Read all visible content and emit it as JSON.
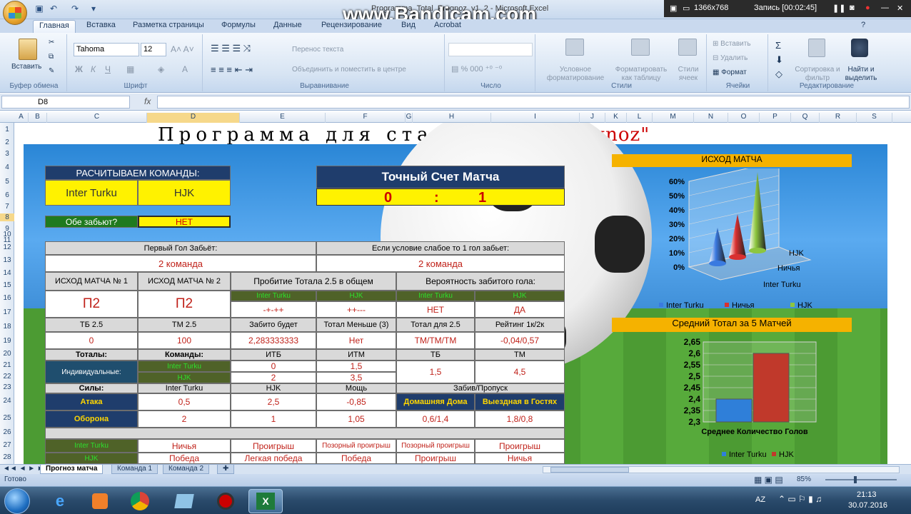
{
  "window": {
    "title": "Programma_Total_Prognoz_v1_2 - Microsoft Excel"
  },
  "recorder": {
    "watermark": "www.Bandicam.com",
    "resolution": "1366x768",
    "record_status": "Запись [00:02:45]"
  },
  "ribbon": {
    "tabs": [
      "Главная",
      "Вставка",
      "Разметка страницы",
      "Формулы",
      "Данные",
      "Рецензирование",
      "Вид",
      "Acrobat"
    ],
    "clipboard": {
      "paste": "Вставить",
      "group": "Буфер обмена"
    },
    "font": {
      "name": "Tahoma",
      "size": "12",
      "group": "Шрифт"
    },
    "alignment": {
      "wrap": "Перенос текста",
      "merge": "Объединить и поместить в центре",
      "group": "Выравнивание"
    },
    "number": {
      "group": "Число"
    },
    "styles": {
      "conditional": "Условное форматирование",
      "as_table": "Форматировать как таблицу",
      "cell_styles": "Стили ячеек",
      "group": "Стили"
    },
    "cells": {
      "insert": "Вставить",
      "delete": "Удалить",
      "format": "Формат",
      "group": "Ячейки"
    },
    "editing": {
      "sort": "Сортировка и фильтр",
      "find": "Найти и выделить",
      "group": "Редактирование"
    }
  },
  "formula_bar": {
    "name_box": "D8",
    "fx": "fx",
    "value": ""
  },
  "columns": [
    "A",
    "B",
    "C",
    "D",
    "E",
    "F",
    "G",
    "H",
    "I",
    "J",
    "K",
    "L",
    "M",
    "N",
    "O",
    "P",
    "Q",
    "R",
    "S"
  ],
  "rows": [
    "1",
    "2",
    "3",
    "4",
    "5",
    "6",
    "7",
    "8",
    "9",
    "10",
    "11",
    "12",
    "13",
    "14",
    "15",
    "16",
    "17",
    "18",
    "19",
    "20",
    "21",
    "22",
    "23",
    "24",
    "25",
    "26",
    "27",
    "28"
  ],
  "sheet": {
    "banner": "Программа для ставок",
    "banner_brand": "\"Total Prognoz\"",
    "calc_header": "РАСЧИТЫВАЕМ КОМАНДЫ:",
    "team1": "Inter Turku",
    "team2": "HJK",
    "score_header": "Точный Счет Матча",
    "score1": "0",
    "score_sep": ":",
    "score2": "1",
    "both_score_label": "Обе забьют?",
    "both_score_value": "НЕТ",
    "first_goal_h": "Первый Гол Забьёт:",
    "first_goal_v": "2 команда",
    "weak_h": "Если условие слабое то 1 гол забьет:",
    "weak_v": "2 команда",
    "outcome1_h": "ИСХОД МАТЧА № 1",
    "outcome2_h": "ИСХОД МАТЧА № 2",
    "outcome1_v": "П2",
    "outcome2_v": "П2",
    "total25_h": "Пробитие Тотала 2.5 в общем",
    "prob_h": "Вероятность забитого гола:",
    "team1_short": "Inter Turku",
    "team2_short": "HJK",
    "total25_t1": "-+-++",
    "total25_t2": "++---",
    "prob_t1": "НЕТ",
    "prob_t2": "ДА",
    "row18": [
      "ТБ 2.5",
      "ТМ 2.5",
      "Забито будет",
      "Тотал Меньше (3)",
      "Тотал для 2.5",
      "Рейтинг 1к/2к"
    ],
    "row19": [
      "0",
      "100",
      "2,283333333",
      "Нет",
      "ТМ/ТМ/ТМ",
      "-0,04/0,57"
    ],
    "row20": [
      "Тоталы:",
      "Команды:",
      "ИТБ",
      "ИТМ",
      "ТБ",
      "ТМ"
    ],
    "individual_label": "Индивидуальные:",
    "itb": [
      "0",
      "2"
    ],
    "itm": [
      "1,5",
      "3,5"
    ],
    "tb_val": "1,5",
    "tm_val": "4,5",
    "row23": [
      "Силы:",
      "Inter Turku",
      "HJK",
      "Мощь",
      "Забив/Пропуск"
    ],
    "attack_label": "Атака",
    "attack": [
      "0,5",
      "2,5",
      "-0,85"
    ],
    "home_label": "Домашняя Дома",
    "away_label": "Выездная в Гостях",
    "defense_label": "Оборона",
    "defense": [
      "2",
      "1",
      "1,05"
    ],
    "home_val": "0,6/1,4",
    "away_val": "1,8/0,8",
    "row27": [
      "Inter Turku",
      "Ничья",
      "Проигрыш",
      "Позорный проигрыш",
      "Позорный проигрыш",
      "Проигрыш"
    ],
    "row28": [
      "HJK",
      "Победа",
      "Легкая победа",
      "Победа",
      "Проигрыш",
      "Ничья"
    ]
  },
  "chart_data": [
    {
      "type": "bar",
      "title": "ИСХОД МАТЧА",
      "categories": [
        "Inter Turku",
        "Ничья",
        "HJK"
      ],
      "series": [
        {
          "name": "Inter Turku",
          "values": [
            0.25
          ]
        },
        {
          "name": "Ничья",
          "values": [
            0.3
          ]
        },
        {
          "name": "HJK",
          "values": [
            0.55
          ]
        }
      ],
      "ylim": [
        0,
        0.6
      ],
      "yticks": [
        "0%",
        "10%",
        "20%",
        "30%",
        "40%",
        "50%",
        "60%"
      ],
      "colors": [
        "#3a7ae0",
        "#d93030",
        "#8dc63f"
      ],
      "legend": "bottom"
    },
    {
      "type": "bar",
      "title": "Средний Тотал за 5 Матчей",
      "xlabel": "Среднее Количество  Голов",
      "series": [
        {
          "name": "Inter Turku",
          "values": [
            2.4
          ]
        },
        {
          "name": "HJK",
          "values": [
            2.6
          ]
        }
      ],
      "ylim": [
        2.3,
        2.65
      ],
      "yticks": [
        "2,3",
        "2,35",
        "2,4",
        "2,45",
        "2,5",
        "2,55",
        "2,6",
        "2,65"
      ],
      "colors": [
        "#2f7fd9",
        "#c0392b"
      ],
      "legend": "bottom"
    }
  ],
  "sheet_tabs": [
    "Прогноз матча",
    "Команда 1",
    "Команда 2"
  ],
  "status": {
    "ready": "Готово",
    "zoom": "85%"
  },
  "taskbar": {
    "lang": "AZ",
    "time": "21:13",
    "date": "30.07.2016"
  }
}
